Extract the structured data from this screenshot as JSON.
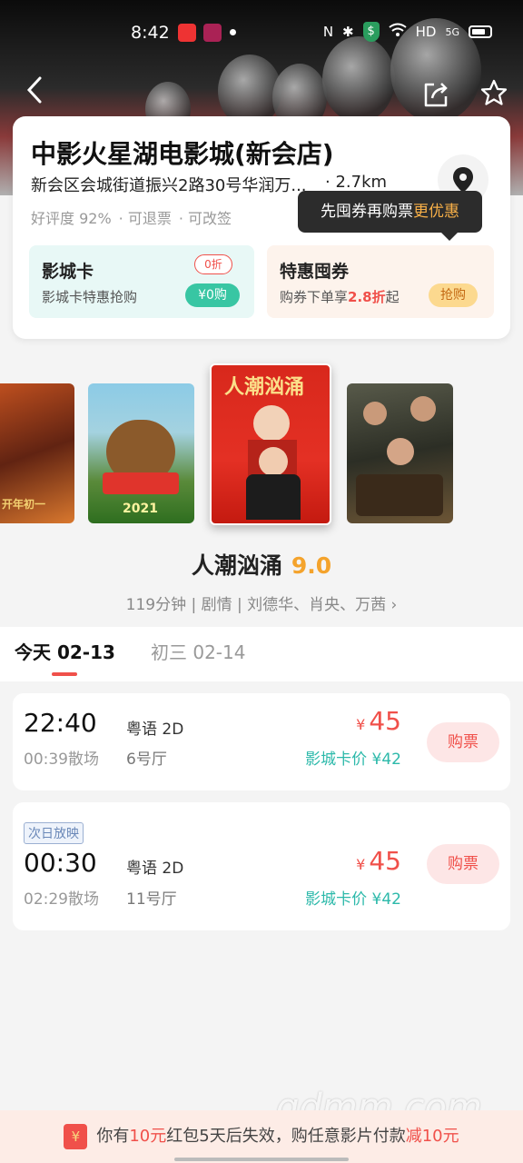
{
  "status_bar": {
    "time": "8:42",
    "network": "HD",
    "signal": "5G"
  },
  "cinema": {
    "name": "中影火星湖电影城(新会店)",
    "address": "新会区会城街道振兴2路30号华润万...",
    "distance": "· 2.7km",
    "tags": [
      "好评度 92%",
      "· 可退票",
      "· 可改签"
    ]
  },
  "tooltip": {
    "text": "先囤券再购票",
    "highlight": "更优惠"
  },
  "promos": {
    "cinema_card": {
      "title": "影城卡",
      "subtitle": "影城卡特惠抢购",
      "discount_badge": "0折",
      "button": "¥0购"
    },
    "coupon": {
      "title": "特惠囤券",
      "subtitle_prefix": "购券下单享",
      "subtitle_discount": "2.8折",
      "subtitle_suffix": "起",
      "button": "抢购"
    }
  },
  "posters": [
    {
      "name": "poster-new-gods",
      "text": "开年初一"
    },
    {
      "name": "poster-boonie-bears",
      "text": "2021"
    },
    {
      "name": "poster-renchao",
      "text": "人潮汹涌"
    },
    {
      "name": "poster-detective",
      "text": ""
    }
  ],
  "selected_movie": {
    "title": "人潮汹涌",
    "score": "9.0",
    "meta": "119分钟 | 剧情 | 刘德华、肖央、万茜 ›"
  },
  "date_tabs": [
    {
      "label": "今天 02-13",
      "active": true
    },
    {
      "label": "初三 02-14",
      "active": false
    }
  ],
  "showtimes": [
    {
      "badge": "",
      "start": "22:40",
      "end": "00:39散场",
      "lang": "粤语 2D",
      "hall": "6号厅",
      "currency": "¥",
      "price": "45",
      "card_price": "影城卡价 ¥42",
      "button": "购票"
    },
    {
      "badge": "次日放映",
      "start": "00:30",
      "end": "02:29散场",
      "lang": "粤语 2D",
      "hall": "11号厅",
      "currency": "¥",
      "price": "45",
      "card_price": "影城卡价 ¥42",
      "button": "购票"
    }
  ],
  "bottom_banner": {
    "icon": "¥",
    "prefix": "你有",
    "amount": "10元",
    "middle": "红包5天后失效，购任意影片付款",
    "suffix": "减10元"
  },
  "watermark": "gdmm.com",
  "colors": {
    "accent_red": "#f0504a",
    "teal": "#2cb9aa",
    "score_orange": "#f4a32c"
  }
}
